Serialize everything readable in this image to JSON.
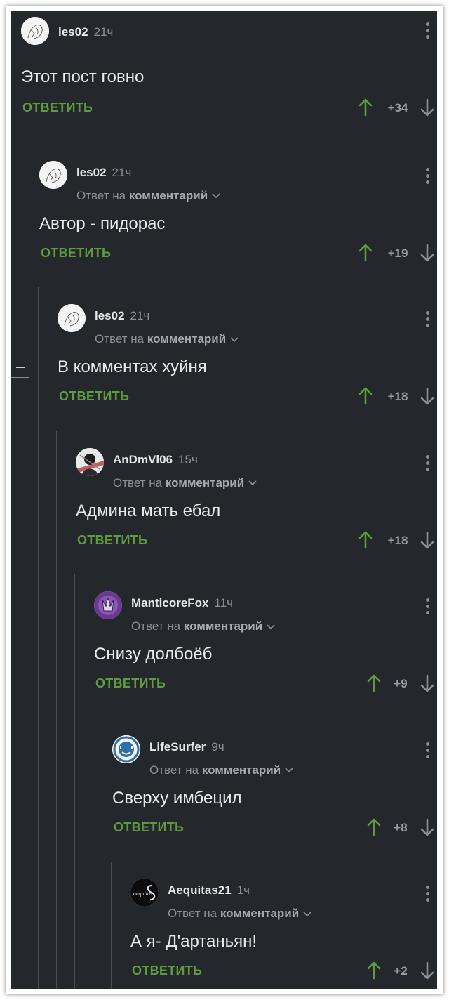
{
  "reply_prefix": "Ответ на ",
  "reply_target": "комментарий",
  "reply_label": "ОТВЕТИТЬ",
  "colors": {
    "background": "#24272b",
    "accent_green": "#5e9a3e",
    "upvote": "#5e9a3e",
    "text": "#e8eaec",
    "muted": "#8c9096"
  },
  "comments": [
    {
      "user": "les02",
      "time": "21ч",
      "text": "Этот пост говно",
      "score": "+34",
      "is_reply": false,
      "avatar": "sketch-avatar"
    },
    {
      "user": "les02",
      "time": "21ч",
      "text": "Автор - пидорас",
      "score": "+19",
      "is_reply": true,
      "avatar": "sketch-avatar"
    },
    {
      "user": "les02",
      "time": "21ч",
      "text": "В комментах хуйня",
      "score": "+18",
      "is_reply": true,
      "avatar": "sketch-avatar"
    },
    {
      "user": "AnDmVl06",
      "time": "15ч",
      "text": "Админа мать ебал",
      "score": "+18",
      "is_reply": true,
      "avatar": "dark-avatar"
    },
    {
      "user": "ManticoreFox",
      "time": "11ч",
      "text": "Снизу долбоёб",
      "score": "+9",
      "is_reply": true,
      "avatar": "purple-avatar"
    },
    {
      "user": "LifeSurfer",
      "time": "9ч",
      "text": "Сверху имбецил",
      "score": "+8",
      "is_reply": true,
      "avatar": "laughing-man-avatar"
    },
    {
      "user": "Aequitas21",
      "time": "1ч",
      "text": "А я- Д'артаньян!",
      "score": "+2",
      "is_reply": true,
      "avatar": "aequitas-logo-avatar"
    }
  ]
}
